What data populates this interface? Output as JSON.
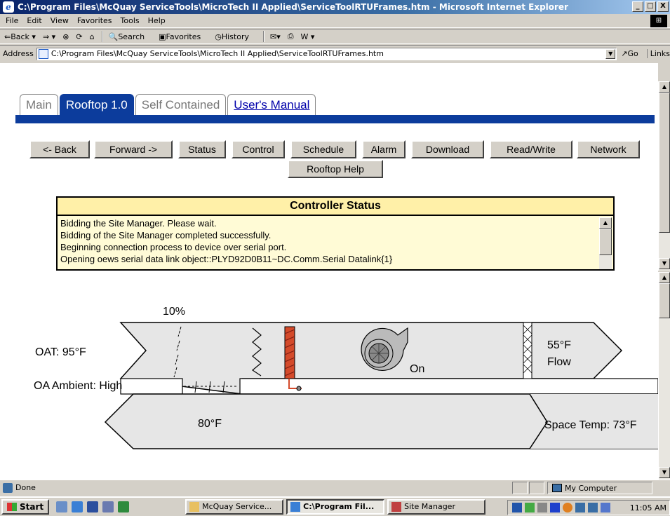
{
  "window": {
    "title": "C:\\Program Files\\McQuay ServiceTools\\MicroTech II Applied\\ServiceToolRTUFrames.htm - Microsoft Internet Explorer",
    "minimize": "_",
    "maximize": "□",
    "close": "X"
  },
  "menu": [
    "File",
    "Edit",
    "View",
    "Favorites",
    "Tools",
    "Help"
  ],
  "toolbar": {
    "back": "⇐Back ▾",
    "forward": "⇒ ▾",
    "stop": "⊗",
    "refresh": "⟳",
    "home": "⌂",
    "search": "Search",
    "favorites": "Favorites",
    "history": "History",
    "mail": "✉▾",
    "print": "⎙",
    "edit": "W ▾"
  },
  "address": {
    "label": "Address",
    "url": "C:\\Program Files\\McQuay ServiceTools\\MicroTech II Applied\\ServiceToolRTUFrames.htm",
    "go": "Go",
    "links": "Links"
  },
  "tabs": [
    {
      "label": "Main",
      "state": "inactive"
    },
    {
      "label": "Rooftop 1.0",
      "state": "active"
    },
    {
      "label": "Self Contained",
      "state": "inactive"
    },
    {
      "label": "User's Manual",
      "state": "link"
    }
  ],
  "nav_buttons": [
    "<- Back",
    "Forward ->",
    "Status",
    "Control",
    "Schedule",
    "Alarm",
    "Download",
    "Read/Write",
    "Network",
    "Rooftop Help"
  ],
  "controller_status": {
    "title": "Controller Status",
    "lines": [
      "Bidding the Site Manager.  Please wait.",
      "Bidding of the Site Manager completed successfully.",
      "Beginning connection process to device over serial port.",
      "Opening oews serial data link object::PLYD92D0B11~DC.Comm.Serial Datalink{1}"
    ]
  },
  "diagram": {
    "damper_pct": "10%",
    "oat": "OAT: 95°F",
    "oa_ambient": "OA Ambient: High",
    "fan_state": "On",
    "supply_temp": "55°F",
    "flow": "Flow",
    "return_temp": "80°F",
    "space_temp": "Space Temp: 73°F"
  },
  "statusbar": {
    "text": "Done",
    "zone": "My Computer"
  },
  "taskbar": {
    "start": "Start",
    "items": [
      {
        "label": "McQuay Service...",
        "active": false
      },
      {
        "label": "C:\\Program Fil...",
        "active": true
      },
      {
        "label": "Site Manager",
        "active": false
      }
    ],
    "clock": "11:05 AM"
  },
  "colors": {
    "tab_blue": "#0c3c9c",
    "status_bg": "#fffbd6",
    "status_head": "#fff0a8",
    "heater": "#d44a2a"
  }
}
